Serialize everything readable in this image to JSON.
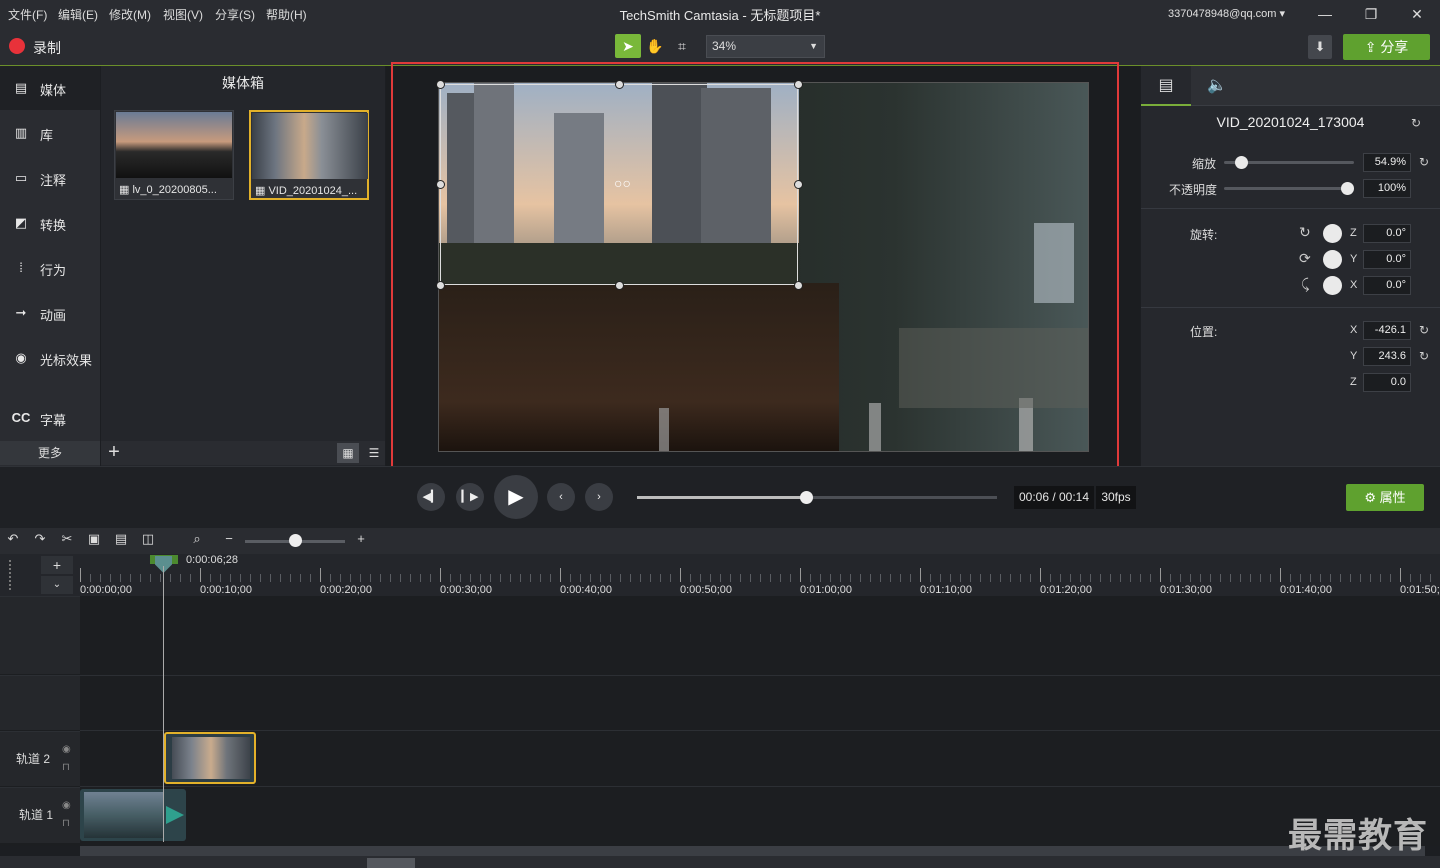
{
  "menu": [
    "文件(F)",
    "编辑(E)",
    "修改(M)",
    "视图(V)",
    "分享(S)",
    "帮助(H)"
  ],
  "app_title": "TechSmith Camtasia - 无标题项目*",
  "account": "3370478948@qq.com",
  "window_controls": [
    "minimize-icon",
    "restore-icon",
    "close-icon"
  ],
  "toolbar": {
    "record_label": "录制",
    "zoom_value": "34%",
    "share_label": "分享",
    "accent_color": "#79b83a"
  },
  "leftnav": {
    "items": [
      {
        "label": "媒体",
        "icon": "film-icon"
      },
      {
        "label": "库",
        "icon": "library-icon"
      },
      {
        "label": "注释",
        "icon": "annotation-icon"
      },
      {
        "label": "转换",
        "icon": "transition-icon"
      },
      {
        "label": "行为",
        "icon": "behavior-icon"
      },
      {
        "label": "动画",
        "icon": "animation-icon"
      },
      {
        "label": "光标效果",
        "icon": "cursor-icon"
      },
      {
        "label": "字幕",
        "icon": "cc-icon"
      }
    ],
    "more_label": "更多"
  },
  "media_bin": {
    "title": "媒体箱",
    "items": [
      {
        "caption": "lv_0_20200805..."
      },
      {
        "caption": "VID_20201024_..."
      }
    ]
  },
  "properties": {
    "clip_name": "VID_20201024_173004",
    "scale_label": "缩放",
    "scale_value": "54.9%",
    "scale_level": 0.13,
    "opacity_label": "不透明度",
    "opacity_value": "100%",
    "opacity_level": 1.0,
    "rotation_label": "旋转:",
    "rotation": [
      {
        "axis": "Z",
        "value": "0.0°"
      },
      {
        "axis": "Y",
        "value": "0.0°"
      },
      {
        "axis": "X",
        "value": "0.0°"
      }
    ],
    "position_label": "位置:",
    "position": [
      {
        "axis": "X",
        "value": "-426.1"
      },
      {
        "axis": "Y",
        "value": "243.6"
      },
      {
        "axis": "Z",
        "value": "0.0"
      }
    ]
  },
  "playback": {
    "time": "00:06 / 00:14",
    "fps": "30fps",
    "progress": 0.47,
    "properties_label": "属性"
  },
  "timeline": {
    "playhead_time": "0:00:06;28",
    "ticks": [
      "0:00:00;00",
      "0:00:10;00",
      "0:00:20;00",
      "0:00:30;00",
      "0:00:40;00",
      "0:00:50;00",
      "0:01:00;00",
      "0:01:10;00",
      "0:01:20;00",
      "0:01:30;00",
      "0:01:40;00",
      "0:01:50;"
    ],
    "tracks": [
      "轨道 2",
      "轨道 1"
    ]
  },
  "watermark": "最需教育"
}
